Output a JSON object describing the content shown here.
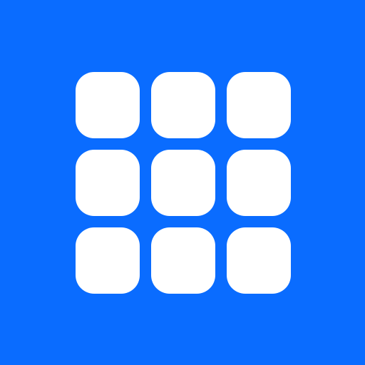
{
  "app_icon": {
    "name": "grid-app-icon",
    "icon": "grid-icon",
    "background_color": "#0A6CFF",
    "tile_color": "#FFFFFF",
    "rows": 3,
    "columns": 3
  }
}
